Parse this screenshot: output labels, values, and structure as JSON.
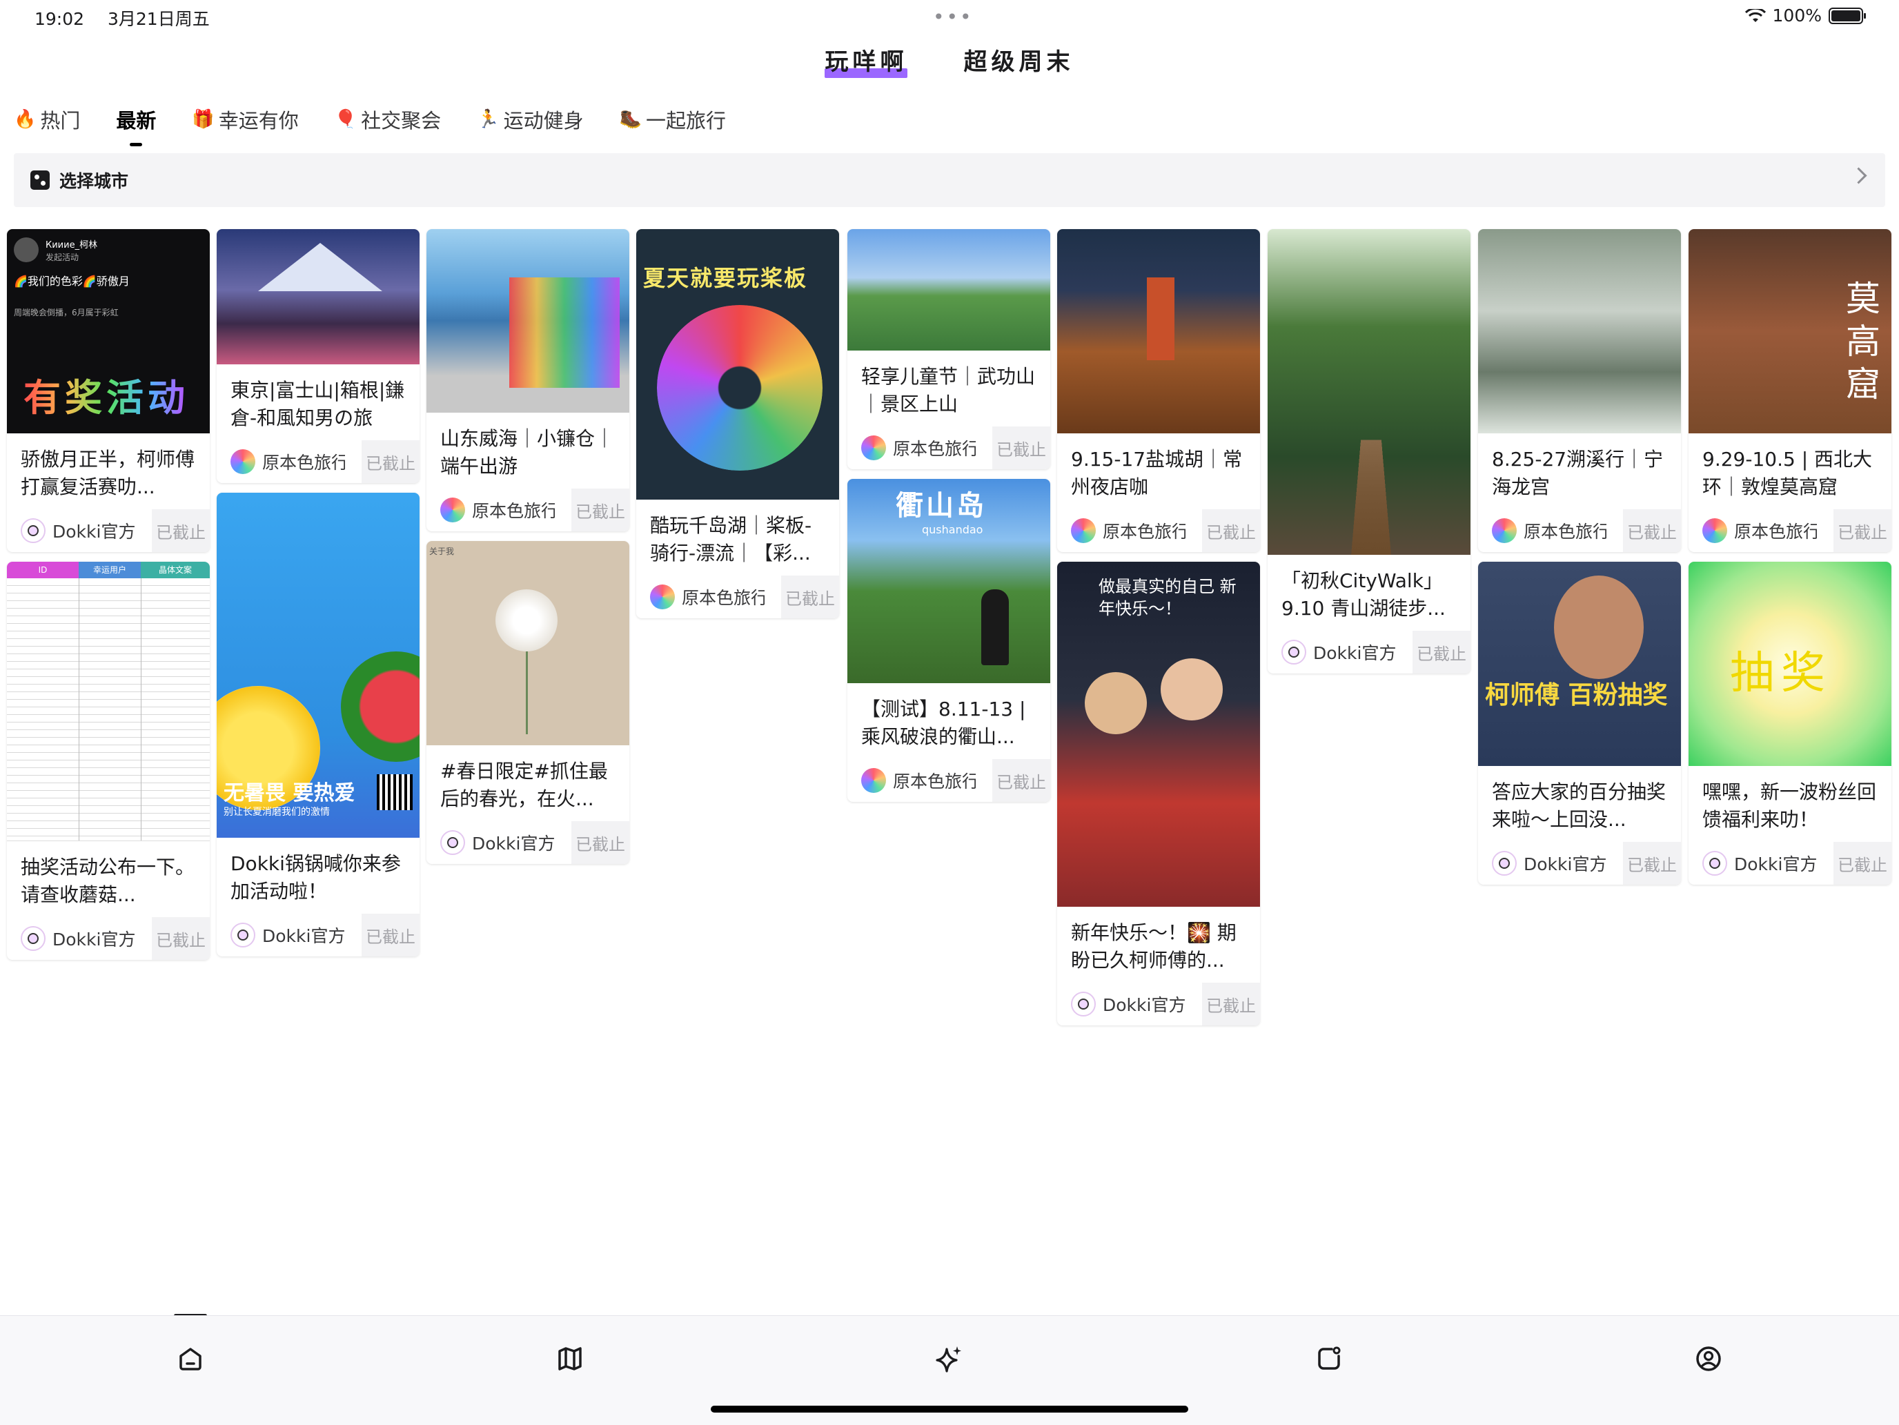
{
  "status": {
    "time": "19:02",
    "date": "3月21日周五",
    "battery": "100%"
  },
  "topnav": {
    "tabs": [
      "玩咩啊",
      "超级周末"
    ]
  },
  "categories": [
    {
      "icon": "🔥",
      "label": "热门"
    },
    {
      "icon": "",
      "label": "最新"
    },
    {
      "icon": "🎁",
      "label": "幸运有你"
    },
    {
      "icon": "🎈",
      "label": "社交聚会"
    },
    {
      "icon": "🏃",
      "label": "运动健身"
    },
    {
      "icon": "🥾",
      "label": "一起旅行"
    }
  ],
  "city": {
    "label": "选择城市"
  },
  "ended_label": "已截止",
  "cards": [
    {
      "title": "骄傲月正半，柯师傅打赢复活赛叻...",
      "author": "Dokki官方",
      "img_text": "有奖活动",
      "img_header_user": "Кииие_柯林",
      "img_header_sub": "发起活动",
      "img_header_line": "🌈我们的色彩🌈骄傲月",
      "img_header_desc": "周端晚会倒播，6月属于彩虹"
    },
    {
      "title": "抽奖活动公布一下。请查收蘑菇...",
      "author": "Dokki官方",
      "table_headers": [
        "ID",
        "幸运用户",
        "晶体文案"
      ]
    },
    {
      "title": "東京|富士山|箱根|鎌倉-和風知男の旅",
      "author": "原本色旅行"
    },
    {
      "title": "Dokki锅锅喊你来参加活动啦！",
      "author": "Dokki官方",
      "img_text": "无暑畏 要热爱",
      "img_sub": "别让长夏消磨我们的激情"
    },
    {
      "title": "山东威海｜小镰仓｜端午出游",
      "author": "原本色旅行"
    },
    {
      "title": "#春日限定#抓住最后的春光，在火...",
      "author": "Dokki官方",
      "img_text": "关于我"
    },
    {
      "title": "酷玩千岛湖｜桨板-骑行-漂流｜【彩...",
      "author": "原本色旅行",
      "img_text": "夏天就要玩桨板"
    },
    {
      "title": "轻享儿童节｜武功山｜景区上山",
      "author": "原本色旅行"
    },
    {
      "title": "【测试】8.11-13 | 乘风破浪的衢山...",
      "author": "原本色旅行",
      "img_text": "衢山岛",
      "img_sub": "qushandao"
    },
    {
      "title": "9.15-17盐城胡｜常州夜店咖",
      "author": "原本色旅行"
    },
    {
      "title": "新年快乐～！🎇 期盼已久柯师傅的...",
      "author": "Dokki官方",
      "img_text": "做最真实的自己 新年快乐～！"
    },
    {
      "title": "「初秋CityWalk」9.10 青山湖徒步...",
      "author": "Dokki官方"
    },
    {
      "title": "8.25-27溯溪行｜宁海龙宫",
      "author": "原本色旅行"
    },
    {
      "title": "答应大家的百分抽奖来啦～上回没...",
      "author": "Dokki官方",
      "img_text": "柯师傅 百粉抽奖"
    },
    {
      "title": "9.29-10.5 | 西北大环｜敦煌莫高窟",
      "author": "原本色旅行",
      "img_text": "莫高窟"
    },
    {
      "title": "嘿嘿，新一波粉丝回馈福利来叻！",
      "author": "Dokki官方",
      "img_text": "抽奖"
    }
  ],
  "colors": {
    "accent": "#9b67ff",
    "ended_bg": "#f2f2f4"
  },
  "bottom_tabs": [
    "home-icon",
    "map-icon",
    "sparkle-icon",
    "notes-icon",
    "profile-icon"
  ]
}
